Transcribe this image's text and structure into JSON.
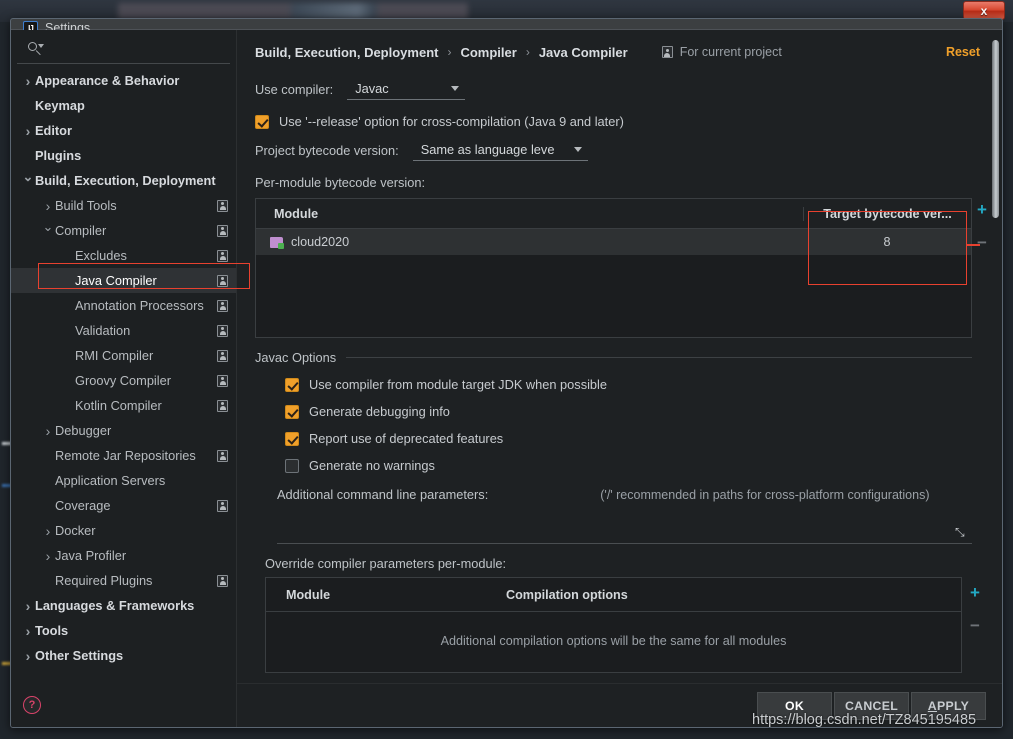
{
  "window": {
    "title": "Settings",
    "logo_text": "IJ",
    "close_label": "x"
  },
  "search": {
    "value": "",
    "placeholder": ""
  },
  "sidebar": {
    "items": [
      {
        "label": "Appearance & Behavior",
        "indent": 0,
        "chev": "closed",
        "bold": true,
        "person": false,
        "selected": false
      },
      {
        "label": "Keymap",
        "indent": 0,
        "chev": "none",
        "bold": true,
        "person": false,
        "selected": false
      },
      {
        "label": "Editor",
        "indent": 0,
        "chev": "closed",
        "bold": true,
        "person": false,
        "selected": false
      },
      {
        "label": "Plugins",
        "indent": 0,
        "chev": "none",
        "bold": true,
        "person": false,
        "selected": false
      },
      {
        "label": "Build, Execution, Deployment",
        "indent": 0,
        "chev": "open",
        "bold": true,
        "person": false,
        "selected": false
      },
      {
        "label": "Build Tools",
        "indent": 1,
        "chev": "closed",
        "bold": false,
        "person": true,
        "selected": false
      },
      {
        "label": "Compiler",
        "indent": 1,
        "chev": "open",
        "bold": false,
        "person": true,
        "selected": false
      },
      {
        "label": "Excludes",
        "indent": 2,
        "chev": "none",
        "bold": false,
        "person": true,
        "selected": false
      },
      {
        "label": "Java Compiler",
        "indent": 2,
        "chev": "none",
        "bold": false,
        "person": true,
        "selected": true
      },
      {
        "label": "Annotation Processors",
        "indent": 2,
        "chev": "none",
        "bold": false,
        "person": true,
        "selected": false
      },
      {
        "label": "Validation",
        "indent": 2,
        "chev": "none",
        "bold": false,
        "person": true,
        "selected": false
      },
      {
        "label": "RMI Compiler",
        "indent": 2,
        "chev": "none",
        "bold": false,
        "person": true,
        "selected": false
      },
      {
        "label": "Groovy Compiler",
        "indent": 2,
        "chev": "none",
        "bold": false,
        "person": true,
        "selected": false
      },
      {
        "label": "Kotlin Compiler",
        "indent": 2,
        "chev": "none",
        "bold": false,
        "person": true,
        "selected": false
      },
      {
        "label": "Debugger",
        "indent": 1,
        "chev": "closed",
        "bold": false,
        "person": false,
        "selected": false
      },
      {
        "label": "Remote Jar Repositories",
        "indent": 1,
        "chev": "none",
        "bold": false,
        "person": true,
        "selected": false
      },
      {
        "label": "Application Servers",
        "indent": 1,
        "chev": "none",
        "bold": false,
        "person": false,
        "selected": false
      },
      {
        "label": "Coverage",
        "indent": 1,
        "chev": "none",
        "bold": false,
        "person": true,
        "selected": false
      },
      {
        "label": "Docker",
        "indent": 1,
        "chev": "closed",
        "bold": false,
        "person": false,
        "selected": false
      },
      {
        "label": "Java Profiler",
        "indent": 1,
        "chev": "closed",
        "bold": false,
        "person": false,
        "selected": false
      },
      {
        "label": "Required Plugins",
        "indent": 1,
        "chev": "none",
        "bold": false,
        "person": true,
        "selected": false
      },
      {
        "label": "Languages & Frameworks",
        "indent": 0,
        "chev": "closed",
        "bold": true,
        "person": false,
        "selected": false
      },
      {
        "label": "Tools",
        "indent": 0,
        "chev": "closed",
        "bold": true,
        "person": false,
        "selected": false
      },
      {
        "label": "Other Settings",
        "indent": 0,
        "chev": "closed",
        "bold": true,
        "person": false,
        "selected": false
      }
    ],
    "help_label": "?"
  },
  "header": {
    "crumb1": "Build, Execution, Deployment",
    "crumb2": "Compiler",
    "crumb3": "Java Compiler",
    "sep": "›",
    "scope_label": "For current project",
    "reset_label": "Reset"
  },
  "compiler": {
    "use_compiler_label": "Use compiler:",
    "use_compiler_value": "Javac",
    "release_option_label": "Use '--release' option for cross-compilation (Java 9 and later)",
    "release_option_checked": true,
    "project_bytecode_label": "Project bytecode version:",
    "project_bytecode_value": "Same as language leve",
    "per_module_label": "Per-module bytecode version:"
  },
  "module_table": {
    "col_module": "Module",
    "col_target": "Target bytecode ver...",
    "rows": [
      {
        "module": "cloud2020",
        "target": "8"
      }
    ],
    "add_label": "+",
    "remove_label": "−"
  },
  "javac_options": {
    "group_title": "Javac Options",
    "checkboxes": [
      {
        "label": "Use compiler from module target JDK when possible",
        "checked": true
      },
      {
        "label": "Generate debugging info",
        "checked": true
      },
      {
        "label": "Report use of deprecated features",
        "checked": true
      },
      {
        "label": "Generate no warnings",
        "checked": false
      }
    ],
    "params_label": "Additional command line parameters:",
    "params_hint": "('/' recommended in paths for cross-platform configurations)",
    "params_value": "",
    "expand_icon": "⤡"
  },
  "override_table": {
    "title": "Override compiler parameters per-module:",
    "col_module": "Module",
    "col_options": "Compilation options",
    "empty_text": "Additional compilation options will be the same for all modules",
    "add_label": "+",
    "remove_label": "−"
  },
  "buttons": {
    "ok": "OK",
    "cancel": "CANCEL",
    "apply_prefix": "A",
    "apply_rest": "PPLY"
  },
  "watermark": {
    "text": "https://blog.csdn.net/TZ845195485"
  },
  "colors": {
    "accent_orange": "#f0a02a",
    "annotation_red": "#e8412f",
    "teal_plus": "#23a9c4",
    "help_red": "#d9436a"
  }
}
